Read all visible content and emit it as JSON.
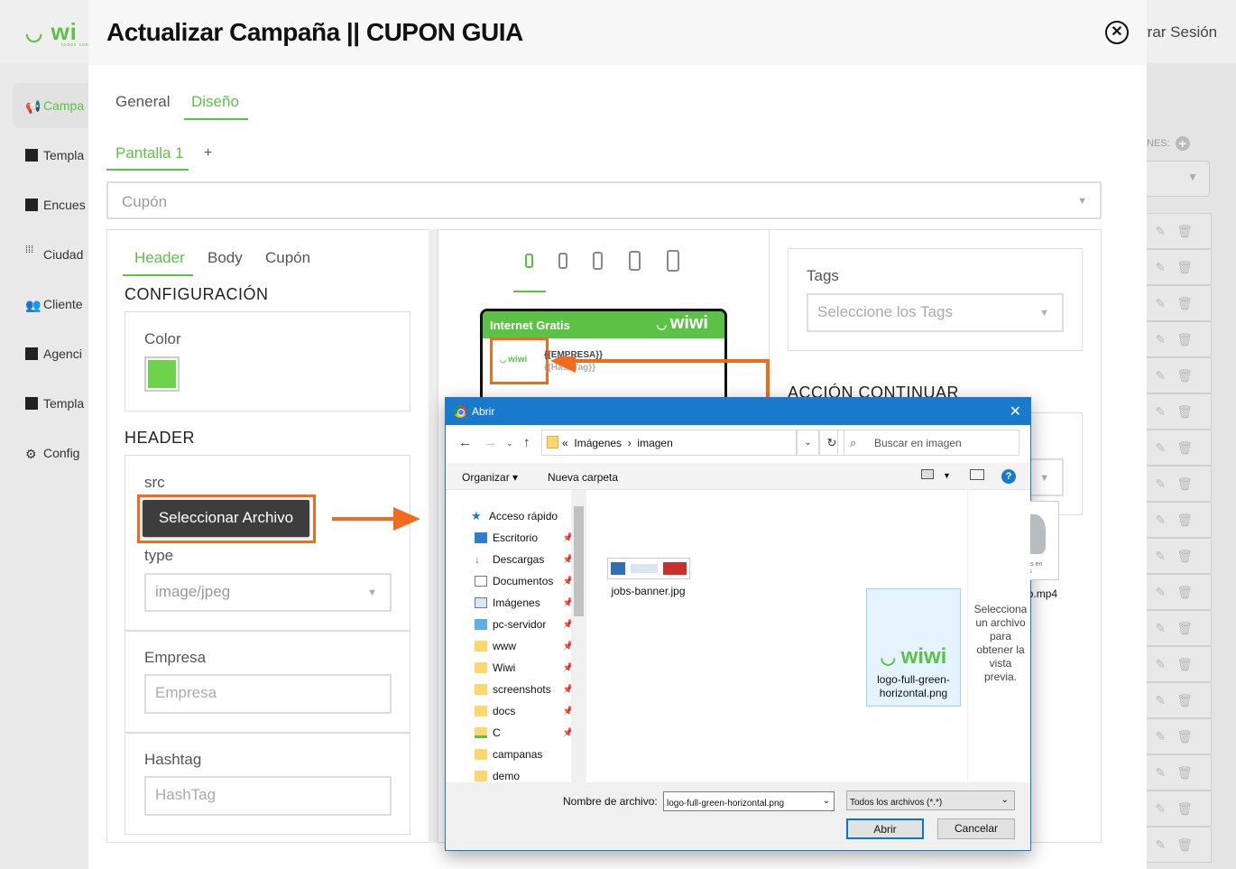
{
  "app": {
    "logo_text": "wi",
    "logo_tagline": "todos conectados",
    "logout_label": "rrar Sesión",
    "sidebar": [
      {
        "label": "Campa",
        "icon": "megaphone-icon",
        "active": true
      },
      {
        "label": "Templa",
        "icon": "template-icon"
      },
      {
        "label": "Encues",
        "icon": "clipboard-icon"
      },
      {
        "label": "Ciudad",
        "icon": "grid-dots-icon"
      },
      {
        "label": "Cliente",
        "icon": "users-icon"
      },
      {
        "label": "Agenci",
        "icon": "building-icon"
      },
      {
        "label": "Templa",
        "icon": "template-icon"
      },
      {
        "label": "Config",
        "icon": "gear-icon"
      }
    ],
    "right_header": "NES:",
    "row_count": 18
  },
  "modal": {
    "title": "Actualizar Campaña || CUPON GUIA",
    "tabs": [
      "General",
      "Diseño"
    ],
    "active_tab": "Diseño",
    "screen_tab": "Pantalla 1",
    "add_screen": "+",
    "template_select": "Cupón",
    "sub_tabs": [
      "Header",
      "Body",
      "Cupón"
    ],
    "config_heading": "CONFIGURACIÓN",
    "color_label": "Color",
    "color_value": "#6fd24c",
    "header_heading": "HEADER",
    "src_label": "src",
    "file_button": "Seleccionar Archivo",
    "type_label": "type",
    "type_value": "image/jpeg",
    "empresa_label": "Empresa",
    "empresa_placeholder": "Empresa",
    "hashtag_label": "Hashtag",
    "hashtag_placeholder": "HashTag",
    "preview": {
      "header_text": "Internet Gratis",
      "logo": "wiwi",
      "logo_small": "wiwi",
      "empresa_var": "{{EMPRESA}}",
      "hashtag_var": "{{HashTag}}"
    },
    "tags_label": "Tags",
    "tags_placeholder": "Seleccione los Tags",
    "accion_heading": "ACCIÓN CONTINUAR"
  },
  "dialog": {
    "title": "Abrir",
    "breadcrumb": [
      "«",
      "Imágenes",
      "›",
      "imagen"
    ],
    "search_placeholder": "Buscar en imagen",
    "organize": "Organizar",
    "new_folder": "Nueva carpeta",
    "help": "?",
    "tree": [
      {
        "label": "Acceso rápido",
        "icon": "star-icon"
      },
      {
        "label": "Escritorio",
        "icon": "desktop-icon"
      },
      {
        "label": "Descargas",
        "icon": "download-icon"
      },
      {
        "label": "Documentos",
        "icon": "document-icon"
      },
      {
        "label": "Imágenes",
        "icon": "pictures-icon"
      },
      {
        "label": "pc-servidor",
        "icon": "monitor-icon"
      },
      {
        "label": "www",
        "icon": "folder-icon"
      },
      {
        "label": "Wiwi",
        "icon": "folder-icon"
      },
      {
        "label": "screenshots",
        "icon": "folder-icon"
      },
      {
        "label": "docs",
        "icon": "folder-icon"
      },
      {
        "label": "C",
        "icon": "network-drive-icon"
      },
      {
        "label": "campanas",
        "icon": "folder-icon"
      },
      {
        "label": "demo",
        "icon": "folder-icon"
      }
    ],
    "files": [
      {
        "name": "jobs-banner.jpg"
      },
      {
        "name": "logo-full-green-horizontal.png",
        "name_lines": [
          "logo-full-green-",
          "horizontal.png"
        ],
        "selected": true
      },
      {
        "name": "Video.mp4",
        "thumb_text": "Estamos en pruebas"
      }
    ],
    "preview_text": "Selecciona un archivo para obtener la vista previa.",
    "filename_label": "Nombre de archivo:",
    "filename_value": "logo-full-green-horizontal.png",
    "filetype_value": "Todos los archivos (*.*)",
    "open_button": "Abrir",
    "cancel_button": "Cancelar"
  },
  "colors": {
    "brand_green": "#5cc246",
    "annotation_orange": "#f26a1b",
    "dialog_blue": "#1979ca"
  }
}
